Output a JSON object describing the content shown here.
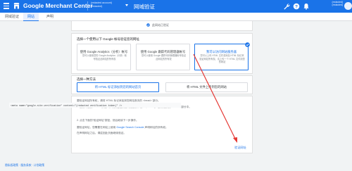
{
  "colors": {
    "brand_blue": "#1a73e8",
    "annotation_red": "#e53935",
    "background": "#f1f3f4"
  },
  "topbar": {
    "menu_icon": "hamburger-menu-icon",
    "logo_icon": "merchant-center-logo-icon",
    "product_name": "Google Merchant Center",
    "account_lines": [
      "(redacted account)",
      "(redacted)"
    ],
    "page_title": "网域验证",
    "tools": [
      "wrench-icon",
      "help-icon",
      "notifications-icon"
    ],
    "user_lines": [
      "(redacted)",
      "(redacted)"
    ]
  },
  "tabs": [
    "网域验证",
    "网站",
    "声明"
  ],
  "verified_note": "此网站已验证",
  "methods_section": {
    "title": "选择一个使用以下 Google 帐号验证您的网址",
    "options": [
      {
        "title": "使用 Google Analytics（分析）帐号",
        "desc": "您可以使用您的 Google Analytics（分析）帐号验证此网站的所有权"
      },
      {
        "title": "使用 Google 跟踪代码管理器帐号",
        "desc": "您可以使用 Google 跟踪代码管理器帐号验证此网站的所有权"
      },
      {
        "title": "我可以访问网站服务器",
        "desc": "您可以上传 HTML 文件或添加 HTML 标记来验证网站所有权。请上传一个 HTML 文件到您的网站"
      }
    ]
  },
  "method2_section": {
    "title": "选择一种方法",
    "choices": [
      "将 HTML 标记添加到您的网站首页",
      "将 HTML 文件上传到您的网站"
    ]
  },
  "instructions": {
    "intro": "要验证网站所有权，请将 HTML 标记添加到您网站首页的 <head> 部分。",
    "step1": "1. 复制下面的 HTML 标记，并将其粘贴到您网站首页中第一个 <body> 部分之前的 <head> 部分中。",
    "code": "<meta name=\"google-site-verification\" content=\"(redacted verification token)\" />",
    "step2": "2. 点击下面的“验证网址”按钮，然后继续下一步操作。",
    "note1_prefix": "要验证网址，您需要在网站上使用 ",
    "note1_link": "Google Search Console",
    "note1_suffix": " 声明网址的所有权。",
    "note2": "在声明网址之后，请返回此页面继续验证。",
    "verify_button": "验证网址"
  },
  "footer_links": "隐私权政策 · 服务条款 · 计划政策"
}
